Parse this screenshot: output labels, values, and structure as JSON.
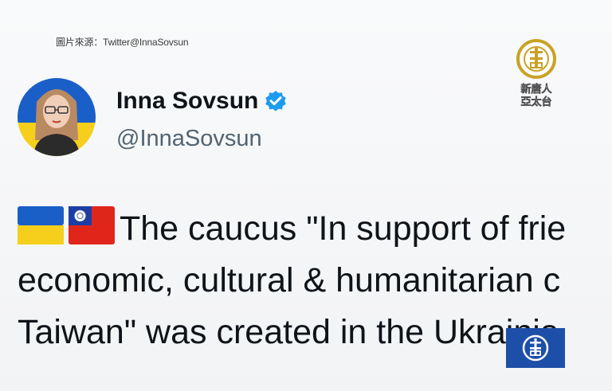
{
  "source_caption": "圖片來源：Twitter@InnaSovsun",
  "watermark": {
    "line1": "新唐人",
    "line2": "亞太台"
  },
  "profile": {
    "name": "Inna Sovsun",
    "handle": "@InnaSovsun",
    "verified": true
  },
  "tweet": {
    "flags": [
      "ukraine-flag",
      "taiwan-flag"
    ],
    "lines": [
      "The caucus \"In support of frie",
      "economic, cultural & humanitarian c",
      "Taiwan\" was created in the Ukrainia"
    ]
  },
  "colors": {
    "ukraine_blue": "#1a5fc8",
    "ukraine_yellow": "#f5cf1b",
    "taiwan_red": "#e0261a",
    "taiwan_blue": "#1d3ea5",
    "verified_blue": "#1d9bf0",
    "logo_gold": "#c9a227",
    "cover_blue": "#1e4fa8"
  }
}
